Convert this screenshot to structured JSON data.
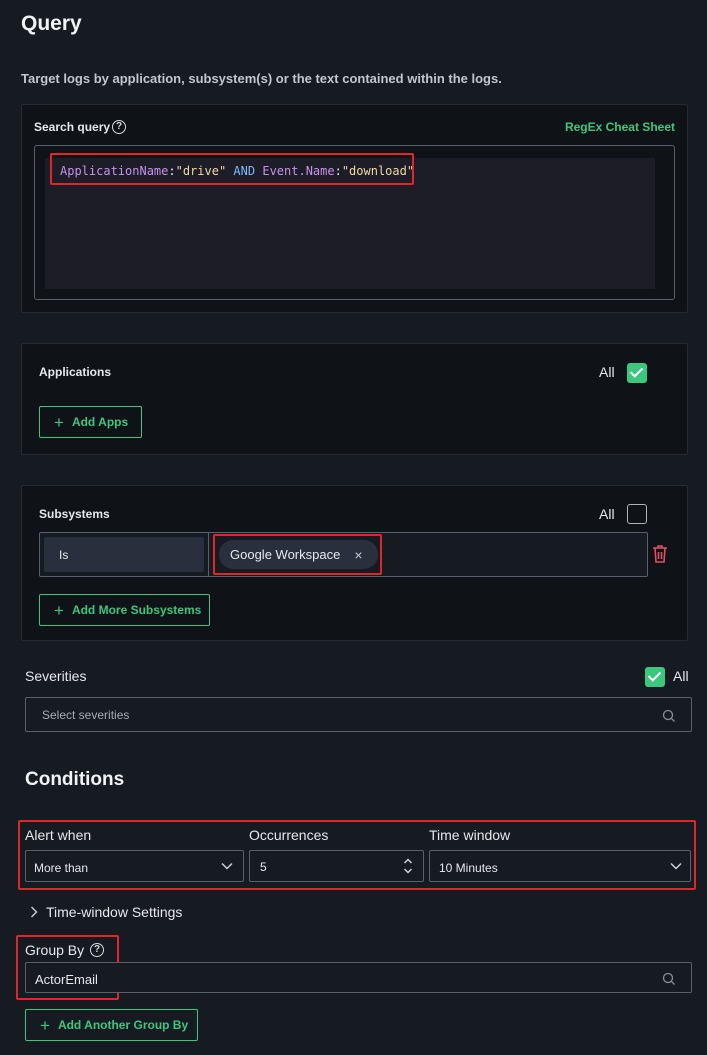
{
  "query_section": {
    "title": "Query",
    "subtitle": "Target logs by application, subsystem(s) or the text contained within the logs.",
    "search_label": "Search query",
    "regex_link": "RegEx Cheat Sheet",
    "query_tokens": {
      "k1": "ApplicationName",
      "c1": ":",
      "v1": "\"drive\"",
      "op": "AND",
      "k2": "Event.Name",
      "c2": ":",
      "v2": "\"download\""
    }
  },
  "applications": {
    "label": "Applications",
    "all_label": "All",
    "all_checked": true,
    "add_button": "Add Apps"
  },
  "subsystems": {
    "label": "Subsystems",
    "all_label": "All",
    "all_checked": false,
    "operator": "Is",
    "chip": "Google Workspace",
    "chip_remove": "×",
    "add_button": "Add More Subsystems"
  },
  "severities": {
    "label": "Severities",
    "all_label": "All",
    "all_checked": true,
    "placeholder": "Select severities"
  },
  "conditions": {
    "title": "Conditions",
    "alert_when_label": "Alert when",
    "alert_when_value": "More than",
    "occurrences_label": "Occurrences",
    "occurrences_value": "5",
    "time_window_label": "Time window",
    "time_window_value": "10 Minutes",
    "time_window_settings": "Time-window Settings"
  },
  "group_by": {
    "label": "Group By",
    "value": "ActorEmail",
    "add_button": "Add Another Group By"
  },
  "colors": {
    "background": "#161a21",
    "panel": "#0f1217",
    "accent_green": "#3cc77f",
    "highlight_red": "#e0262b",
    "delete_red": "#e05060"
  }
}
